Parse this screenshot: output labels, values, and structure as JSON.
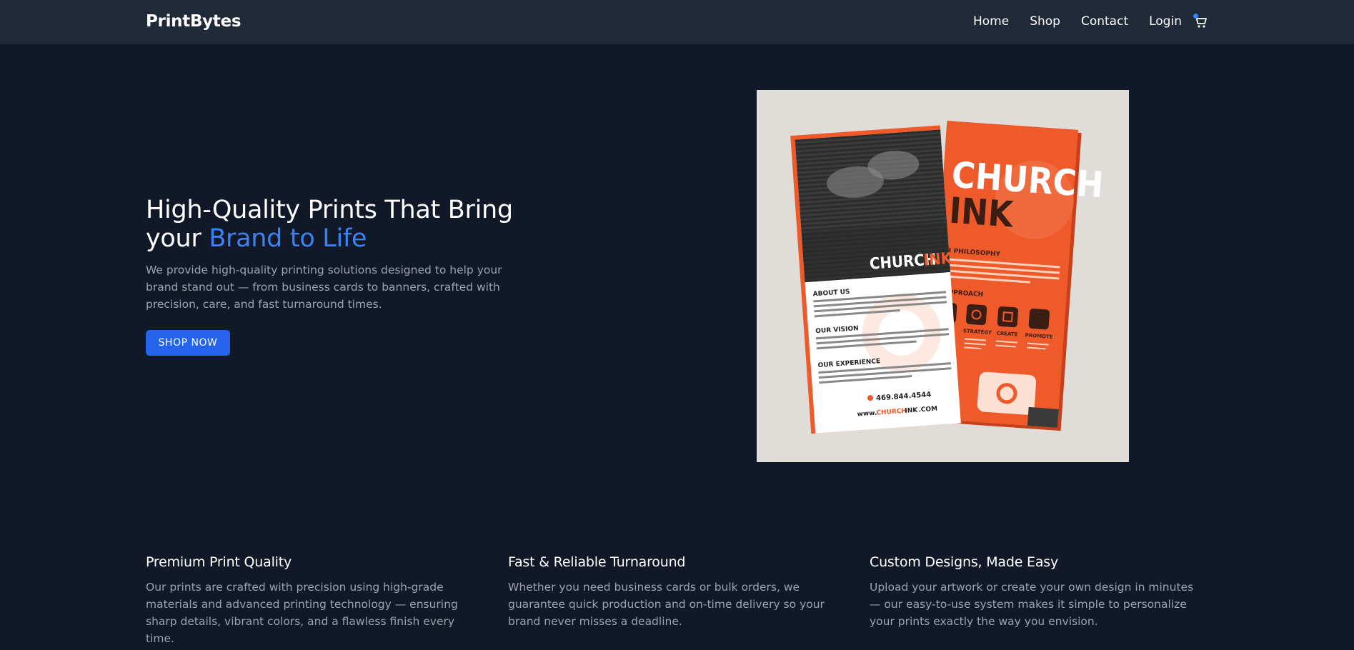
{
  "header": {
    "brand": "PrintBytes",
    "nav": [
      "Home",
      "Shop",
      "Contact",
      "Login"
    ],
    "cart_icon": "cart-icon",
    "cart_dot_color": "#3b82f6"
  },
  "hero": {
    "title_plain": "High-Quality Prints That Bring your ",
    "title_accent": "Brand to Life",
    "description": "We provide high-quality printing solutions designed to help your brand stand out — from business cards to banners, crafted with precision, care, and fast turnaround times.",
    "cta_label": "SHOP NOW",
    "accent_color": "#3b82f6",
    "button_color": "#2563eb",
    "image": {
      "front_brand_a": "CHURCH",
      "front_brand_b": "INK",
      "back_title_a": "CHURCH",
      "back_title_b": "INK",
      "sections": [
        "ABOUT US",
        "OUR VISION",
        "OUR EXPERIENCE"
      ],
      "phone": "469.844.4544",
      "url_a": "www.",
      "url_b": "CHURCH",
      "url_c": "INK",
      "url_d": ".COM",
      "back_headings": [
        "R PHILOSOPHY",
        "APPROACH",
        "CH"
      ],
      "back_steps": [
        "CH",
        "STRATEGY",
        "CREATE",
        "PROMOTE"
      ],
      "lorem": "Lorem ipsum dolor lorem dolor met dolor consectetur adipi-"
    }
  },
  "features": [
    {
      "title": "Premium Print Quality",
      "description": "Our prints are crafted with precision using high-grade materials and advanced printing technology — ensuring sharp details, vibrant colors, and a flawless finish every time."
    },
    {
      "title": "Fast & Reliable Turnaround",
      "description": "Whether you need business cards or bulk orders, we guarantee quick production and on-time delivery so your brand never misses a deadline."
    },
    {
      "title": "Custom Designs, Made Easy",
      "description": "Upload your artwork or create your own design in minutes — our easy-to-use system makes it simple to personalize your prints exactly the way you envision."
    }
  ]
}
